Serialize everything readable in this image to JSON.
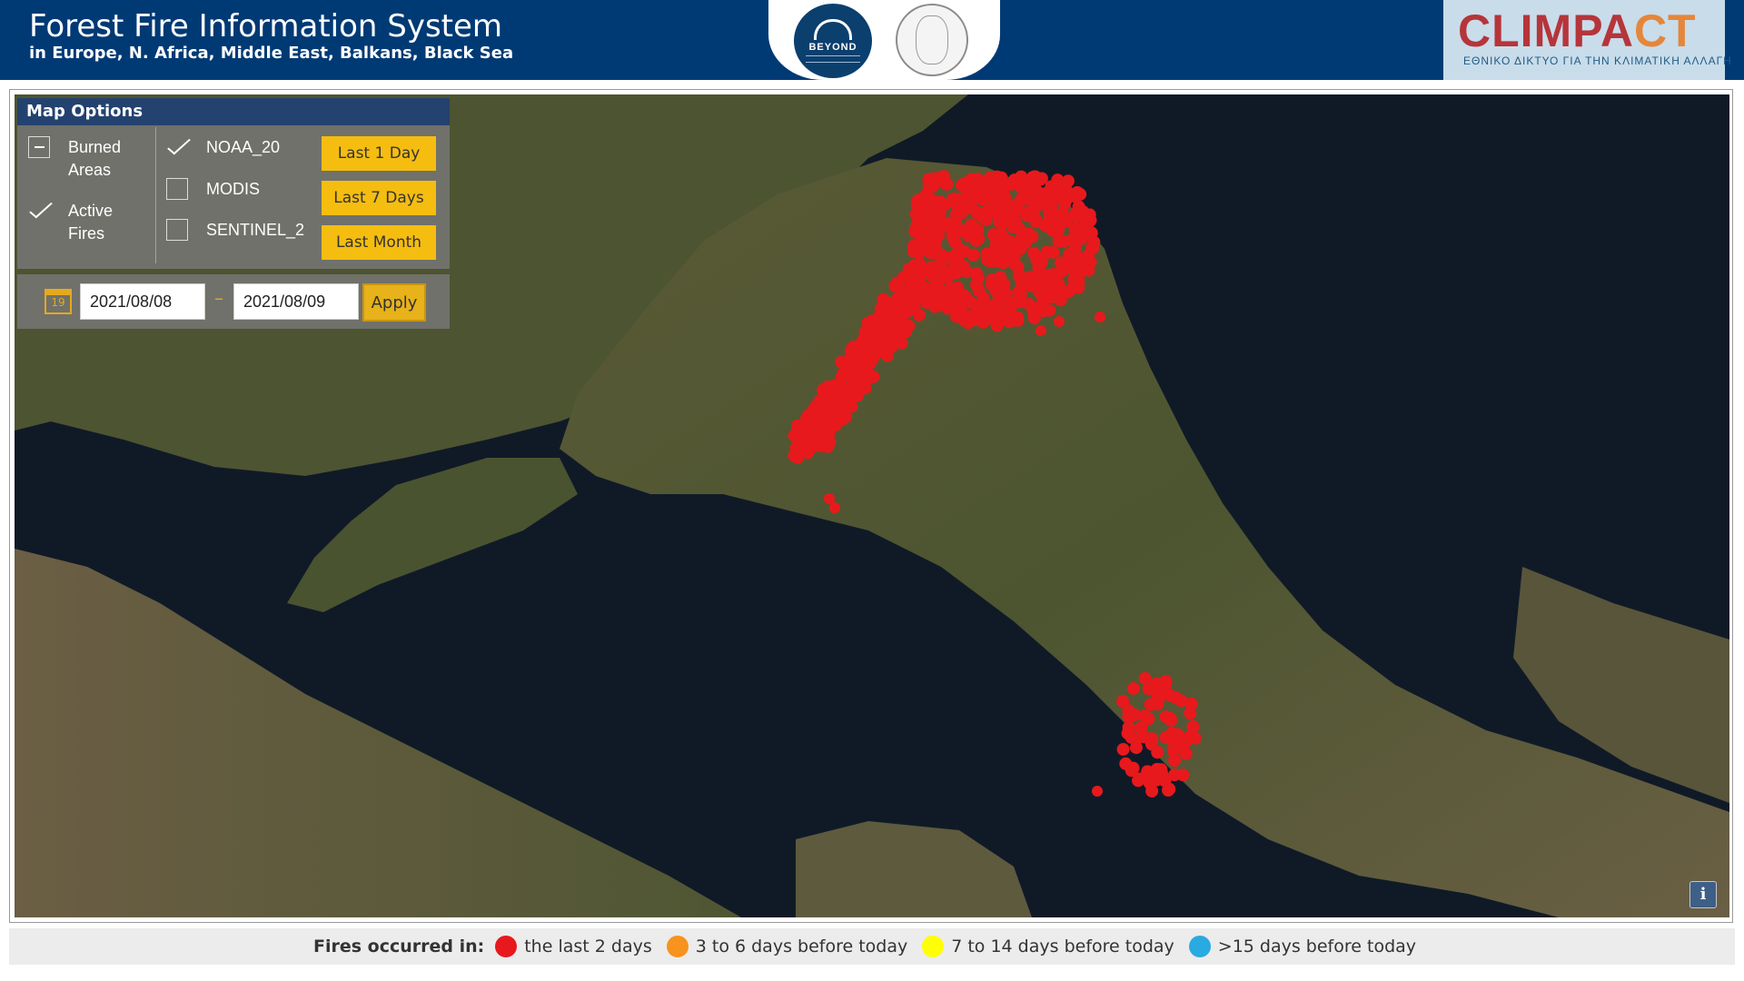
{
  "header": {
    "title": "Forest Fire Information System",
    "subtitle": "in Europe, N. Africa, Middle East, Balkans, Black Sea",
    "beyond_logo_text": "BEYOND",
    "climpact_word": "CLIMPACT",
    "climpact_tagline": "ΕΘΝΙΚΟ ΔΙΚΤΥΟ ΓΙΑ ΤΗΝ ΚΛΙΜΑΤΙΚΗ ΑΛΛΑΓΗ",
    "colors": {
      "bar": "#003a74",
      "climpact_red": "#b5353a",
      "climpact_orange": "#e5863a"
    }
  },
  "map_options": {
    "title": "Map Options",
    "layers": [
      {
        "label": "Burned Areas",
        "state": "partial"
      },
      {
        "label": "Active Fires",
        "state": "checked"
      }
    ],
    "sensors": [
      {
        "label": "NOAA_20",
        "checked": true
      },
      {
        "label": "MODIS",
        "checked": false
      },
      {
        "label": "SENTINEL_2",
        "checked": false
      }
    ],
    "time_buttons": [
      "Last 1 Day",
      "Last 7 Days",
      "Last Month"
    ],
    "accent_color": "#f5bd10"
  },
  "date_filter": {
    "calendar_icon": "calendar-icon",
    "calendar_day": "19",
    "start_date": "2021/08/08",
    "separator": "–",
    "end_date": "2021/08/09",
    "apply_label": "Apply"
  },
  "info_button": {
    "label": "i",
    "icon": "info-icon"
  },
  "legend": {
    "title": "Fires occurred in:",
    "items": [
      {
        "label": "the last 2 days",
        "color": "#e8191c"
      },
      {
        "label": "3 to 6 days before today",
        "color": "#f7931e"
      },
      {
        "label": "7 to 14 days before today",
        "color": "#ffff00"
      },
      {
        "label": ">15 days before today",
        "color": "#29aae1"
      }
    ]
  }
}
